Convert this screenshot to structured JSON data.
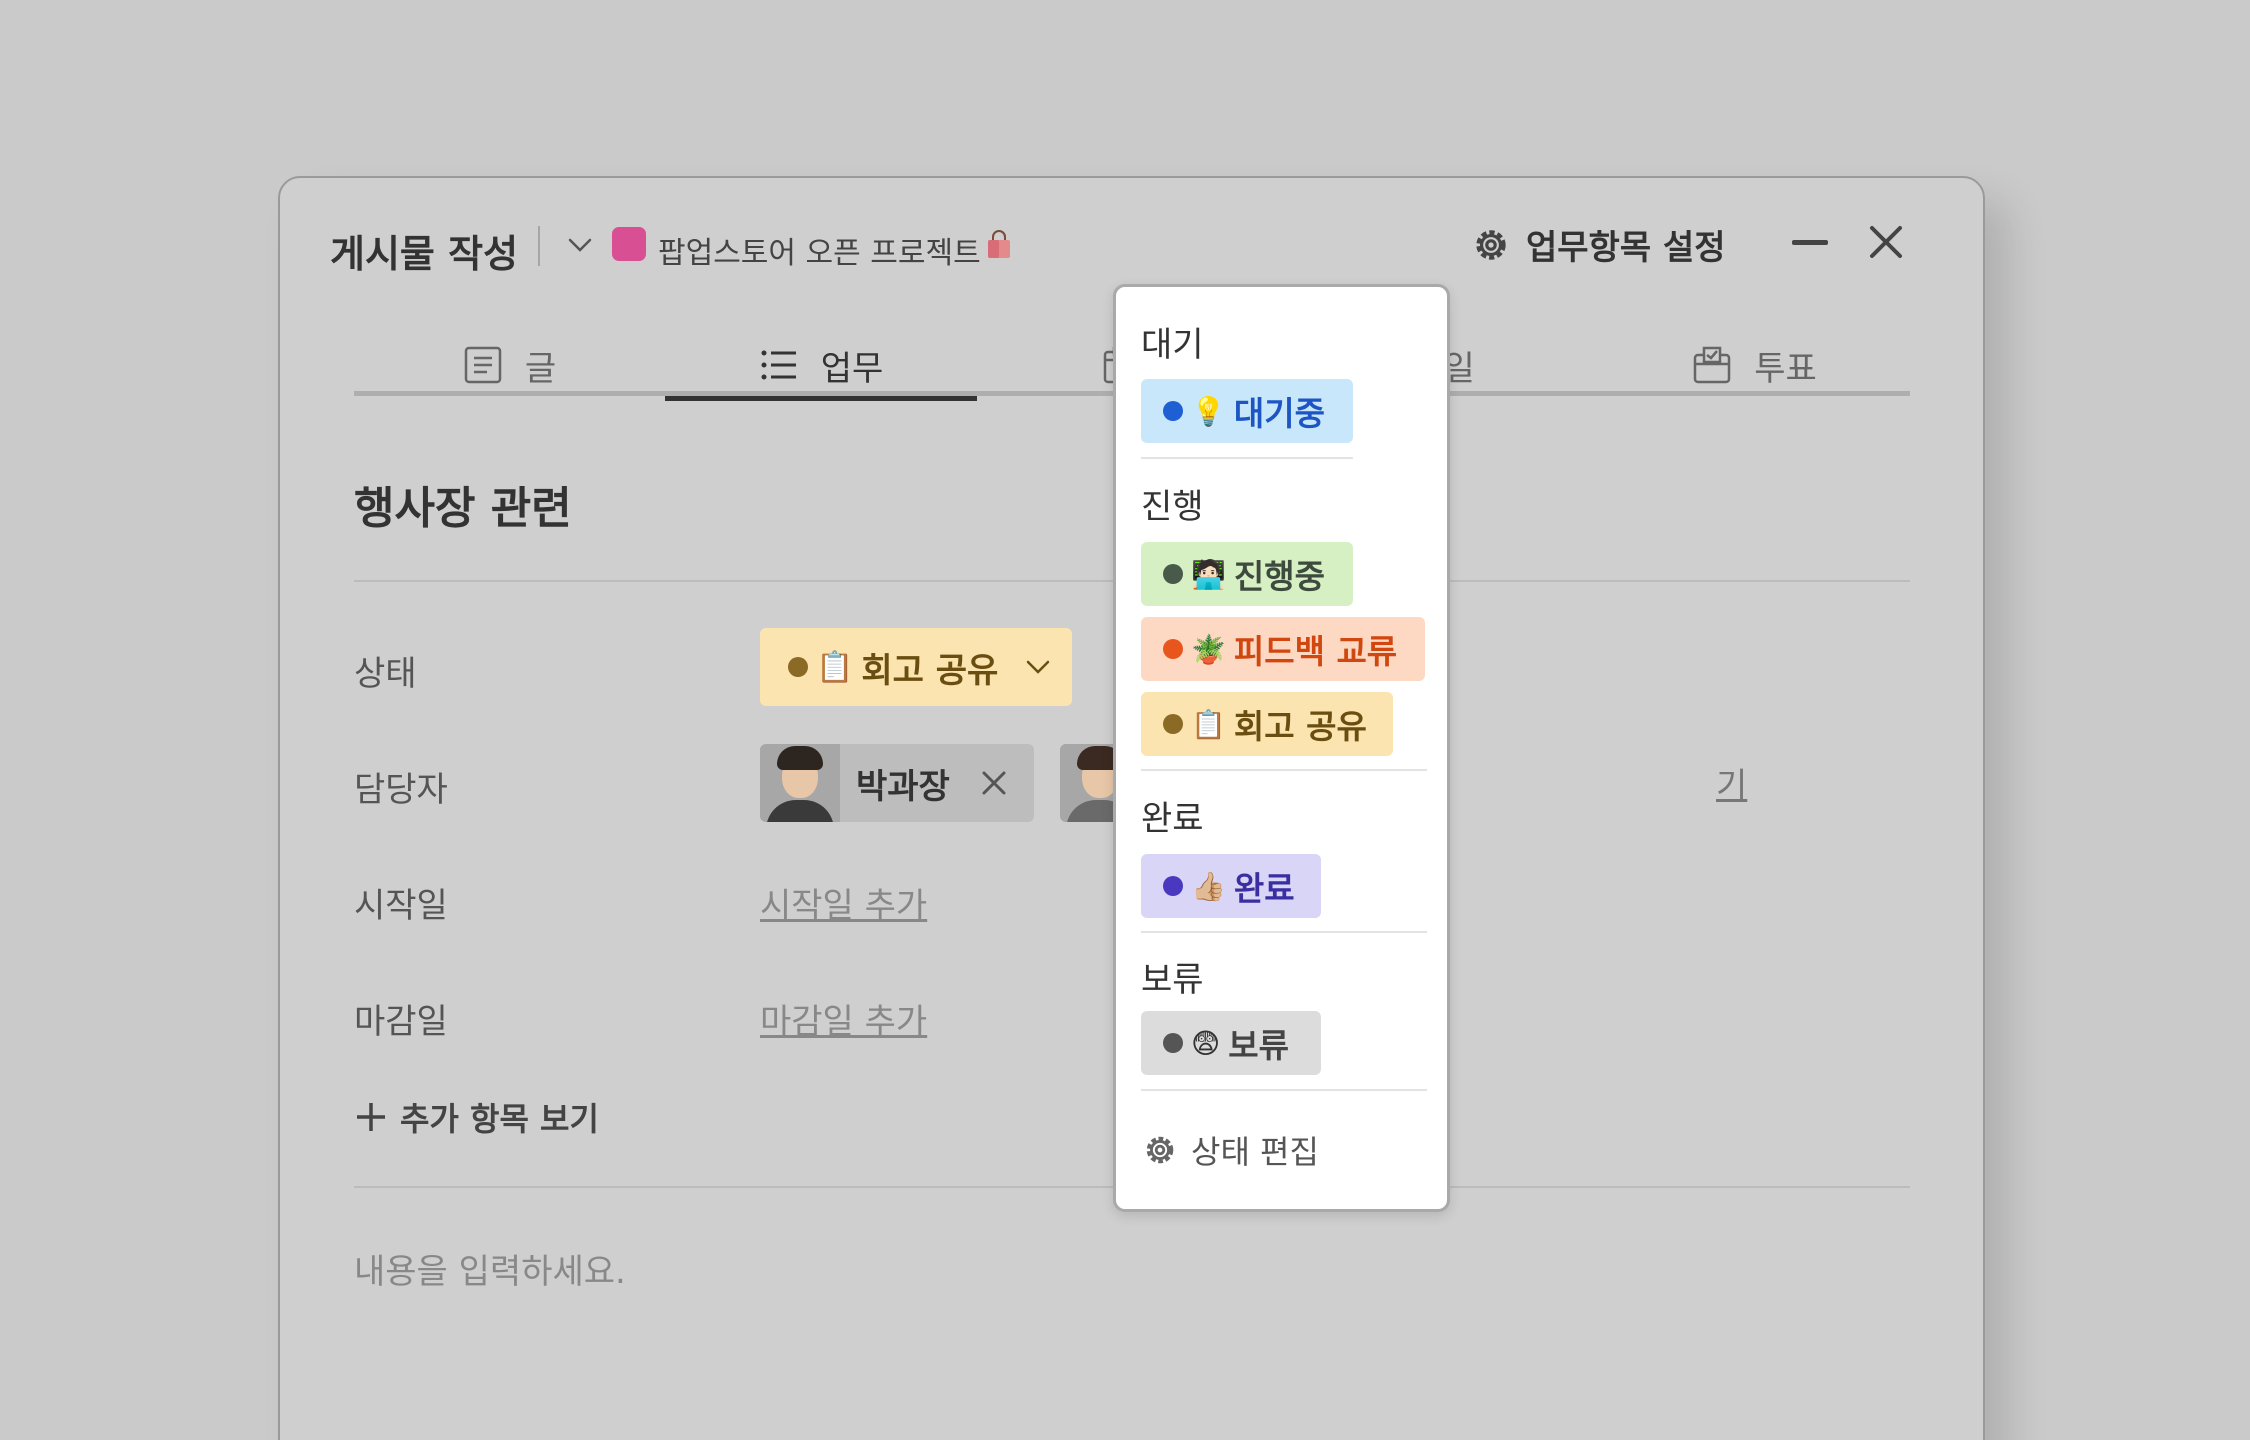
{
  "header": {
    "title": "게시물 작성",
    "project_name": "팝업스토어 오픈 프로젝트",
    "project_color": "#d94f94",
    "settings_label": "업무항목 설정"
  },
  "tabs": [
    {
      "label": "글",
      "icon": "document-icon"
    },
    {
      "label": "업무",
      "icon": "list-icon"
    },
    {
      "label": "",
      "icon": "calendar-icon"
    },
    {
      "label": "할일",
      "icon": "checklist-icon"
    },
    {
      "label": "투표",
      "icon": "vote-box-icon"
    }
  ],
  "task": {
    "title": "행사장 관련",
    "status_label": "상태",
    "status_value": "회고 공유",
    "status_emoji": "📋",
    "assignee_label": "담당자",
    "assignee_name": "박과장",
    "assign_link_fragment": "기",
    "start_label": "시작일",
    "start_value": "시작일 추가",
    "due_label": "마감일",
    "due_value": "마감일 추가",
    "more_items": "추가 항목 보기",
    "content_placeholder": "내용을 입력하세요."
  },
  "status_menu": {
    "groups": [
      {
        "label": "대기",
        "options": [
          {
            "emoji": "💡",
            "label": "대기중",
            "bg": "#c9e7fb",
            "dot": "#1e5fd4",
            "text": "#1d56c4"
          }
        ]
      },
      {
        "label": "진행",
        "options": [
          {
            "emoji": "🧑🏻‍💻",
            "label": "진행중",
            "bg": "#d6f0c4",
            "dot": "#4a5a4a",
            "text": "#3d4a3d"
          },
          {
            "emoji": "🪴",
            "label": "피드백 교류",
            "bg": "#fdd9c4",
            "dot": "#e8561e",
            "text": "#d0480f"
          },
          {
            "emoji": "📋",
            "label": "회고 공유",
            "bg": "#fbe4b0",
            "dot": "#8a6a25",
            "text": "#6a4d10"
          }
        ]
      },
      {
        "label": "완료",
        "options": [
          {
            "emoji": "👍🏼",
            "label": "완료",
            "bg": "#d8d5f6",
            "dot": "#4a39c0",
            "text": "#3a2fa0"
          }
        ]
      },
      {
        "label": "보류",
        "options": [
          {
            "emoji": "😨",
            "label": "보류",
            "bg": "#dcdcdc",
            "dot": "#555555",
            "text": "#444444"
          }
        ]
      }
    ],
    "edit_label": "상태 편집"
  }
}
